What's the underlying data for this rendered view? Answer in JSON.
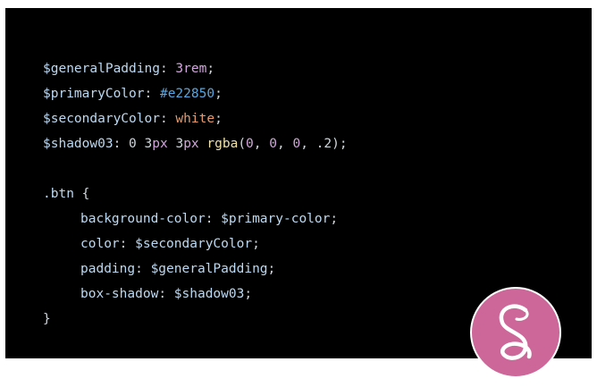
{
  "code": {
    "line1": {
      "var": "$generalPadding",
      "colon": ": ",
      "num": "3",
      "unit": "rem",
      "semi": ";"
    },
    "line2": {
      "var": "$primaryColor",
      "colon": ": ",
      "hex": "#e22850",
      "semi": ";"
    },
    "line3": {
      "var": "$secondaryColor",
      "colon": ": ",
      "color": "white",
      "semi": ";"
    },
    "line4": {
      "var": "$shadow03",
      "colon": ": ",
      "n1": "0",
      "sp1": " ",
      "n2": "3",
      "u2": "px",
      "sp2": " ",
      "n3": "3",
      "u3": "px",
      "sp3": " ",
      "func": "rgba",
      "open": "(",
      "a1": "0",
      "c1": ", ",
      "a2": "0",
      "c2": ", ",
      "a3": "0",
      "c3": ", ",
      "a4": ".2",
      "close": ")",
      "semi": ";"
    },
    "selector": ".btn",
    "brace_open": " {",
    "rule1": {
      "prop": "background-color",
      "colon": ": ",
      "value": "$primary-color",
      "semi": ";"
    },
    "rule2": {
      "prop": "color",
      "colon": ": ",
      "value": "$secondaryColor",
      "semi": ";"
    },
    "rule3": {
      "prop": "padding",
      "colon": ": ",
      "value": "$generalPadding",
      "semi": ";"
    },
    "rule4": {
      "prop": "box-shadow",
      "colon": ": ",
      "value": "$shadow03",
      "semi": ";"
    },
    "brace_close": "}"
  },
  "logo": {
    "icon": "sass-logo-icon",
    "background": "#cd6799"
  },
  "colors": {
    "panel_background": "#000000",
    "variable": "#bcd9f3",
    "number": "#d3a5de",
    "hex": "#5aa6e0",
    "keyword_color": "#e89a6a",
    "function": "#f0e2a8"
  }
}
